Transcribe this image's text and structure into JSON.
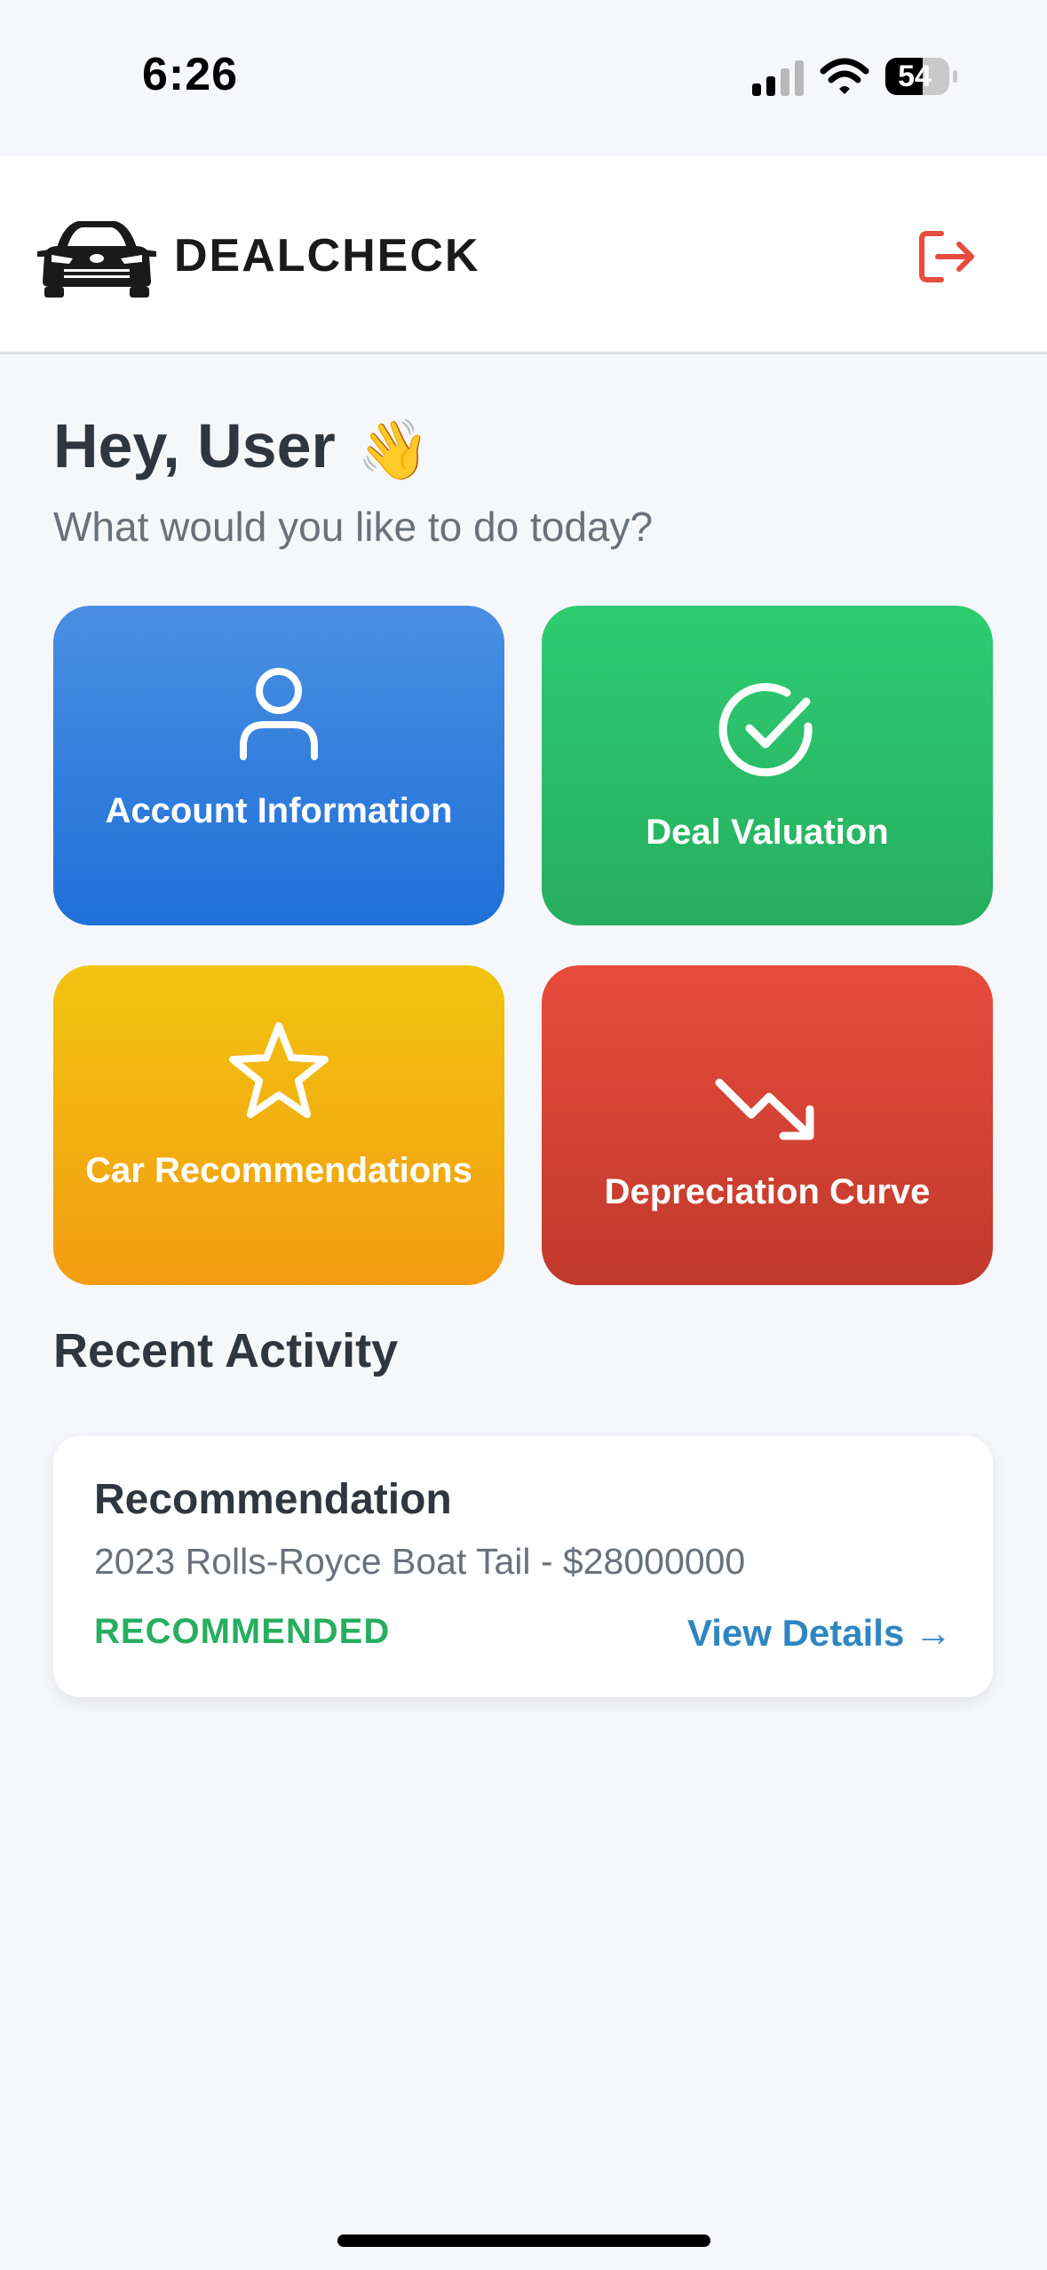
{
  "status_bar": {
    "time": "6:26",
    "battery": "54"
  },
  "header": {
    "brand": "DEALCHECK",
    "logo_icon": "car-front-icon",
    "logout_icon": "logout-icon",
    "accent_color": "#e74c3c"
  },
  "greeting": {
    "title": "Hey, User",
    "emoji": "👋",
    "subtitle": "What would you like to do today?"
  },
  "actions": [
    {
      "label": "Account Information",
      "icon": "user-icon",
      "color": "#2f7fdc"
    },
    {
      "label": "Deal Valuation",
      "icon": "check-circle-icon",
      "color": "#2ebd65"
    },
    {
      "label": "Car Recommendations",
      "icon": "star-icon",
      "color": "#f2b20f"
    },
    {
      "label": "Depreciation Curve",
      "icon": "trending-down-icon",
      "color": "#d9443a"
    }
  ],
  "recent_activity": {
    "section_title": "Recent Activity",
    "items": [
      {
        "title": "Recommendation",
        "subtitle": "2023 Rolls-Royce Boat Tail - $28000000",
        "status": "RECOMMENDED",
        "status_color": "#27ae60",
        "link": "View Details →",
        "link_color": "#2e86c1"
      }
    ]
  }
}
